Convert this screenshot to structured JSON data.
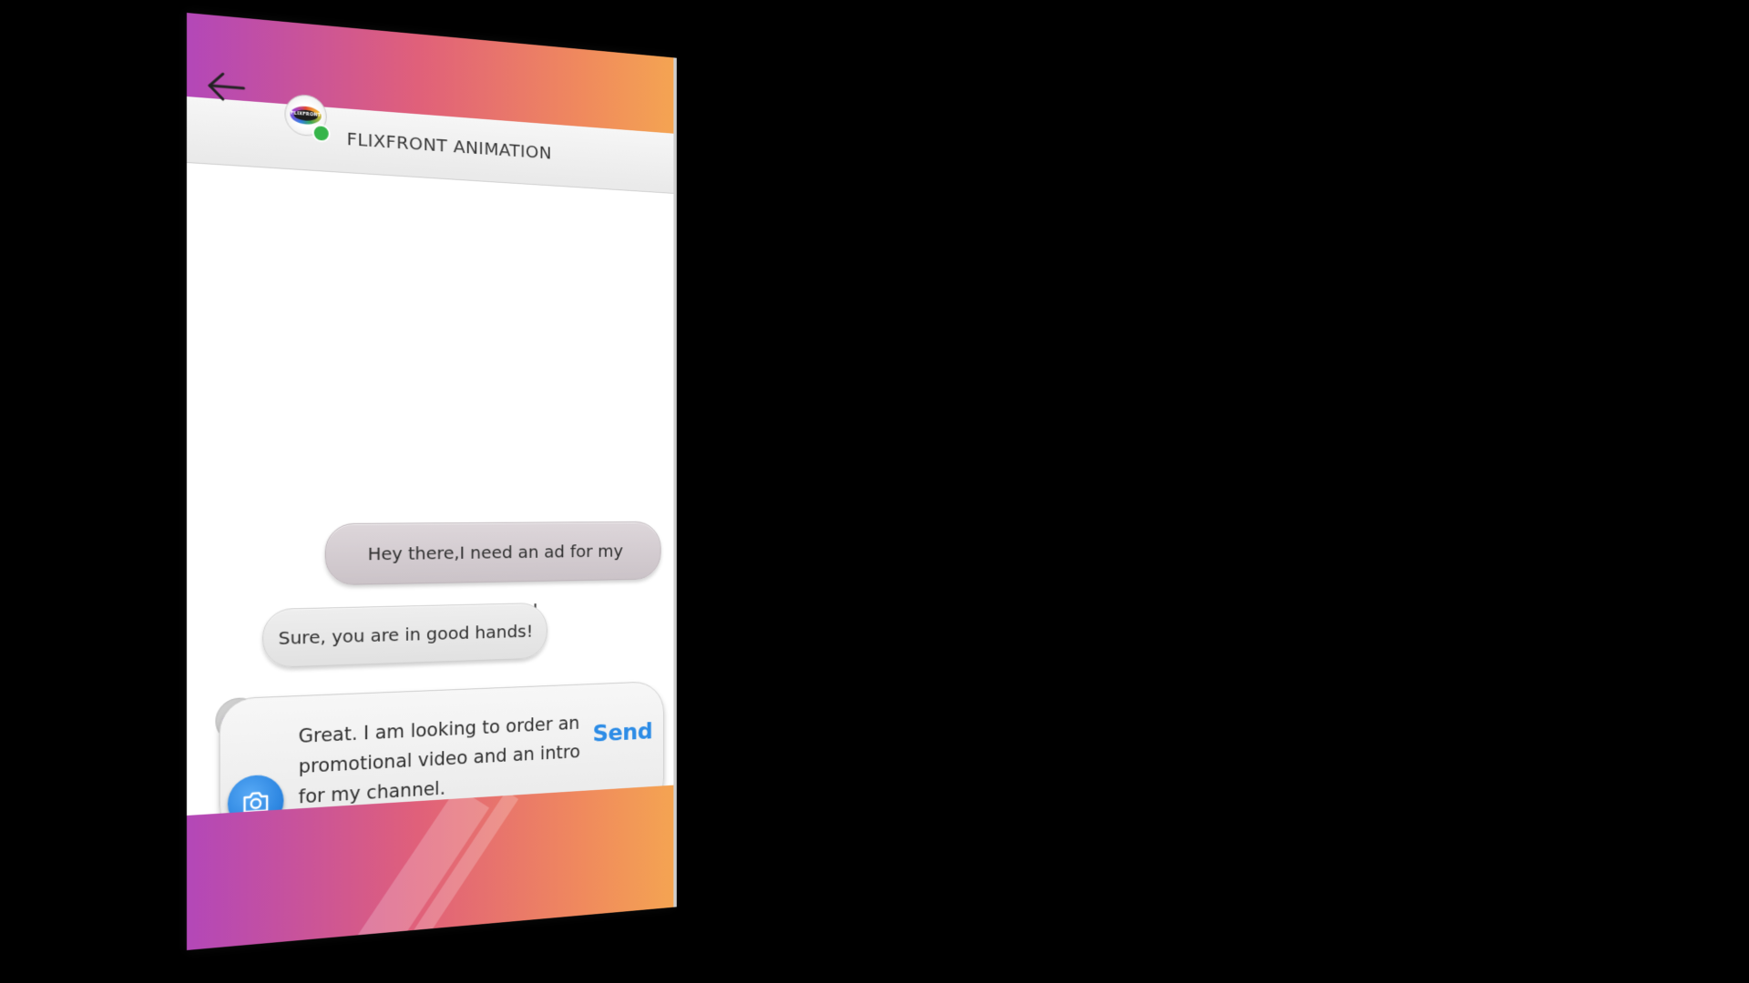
{
  "header": {
    "contact_name": "FLIXFRONT ANIMATION",
    "avatar_text": "FLIXFRONT",
    "status": "online"
  },
  "messages": [
    {
      "direction": "sent",
      "text": "Hey there,I need an ad for my business!"
    },
    {
      "direction": "received",
      "text": "Sure, you are in good hands!"
    }
  ],
  "composer": {
    "value": "Great. I am looking to order an promotional video and an intro for my channel.",
    "send_label": "Send"
  },
  "icons": {
    "back": "arrow-left-icon",
    "camera": "camera-icon",
    "heart": "heart-icon"
  },
  "colors": {
    "gradient_start": "#b347b8",
    "gradient_mid": "#e0607a",
    "gradient_end": "#f4a452",
    "send": "#2d8ce6",
    "online": "#36b54a"
  }
}
